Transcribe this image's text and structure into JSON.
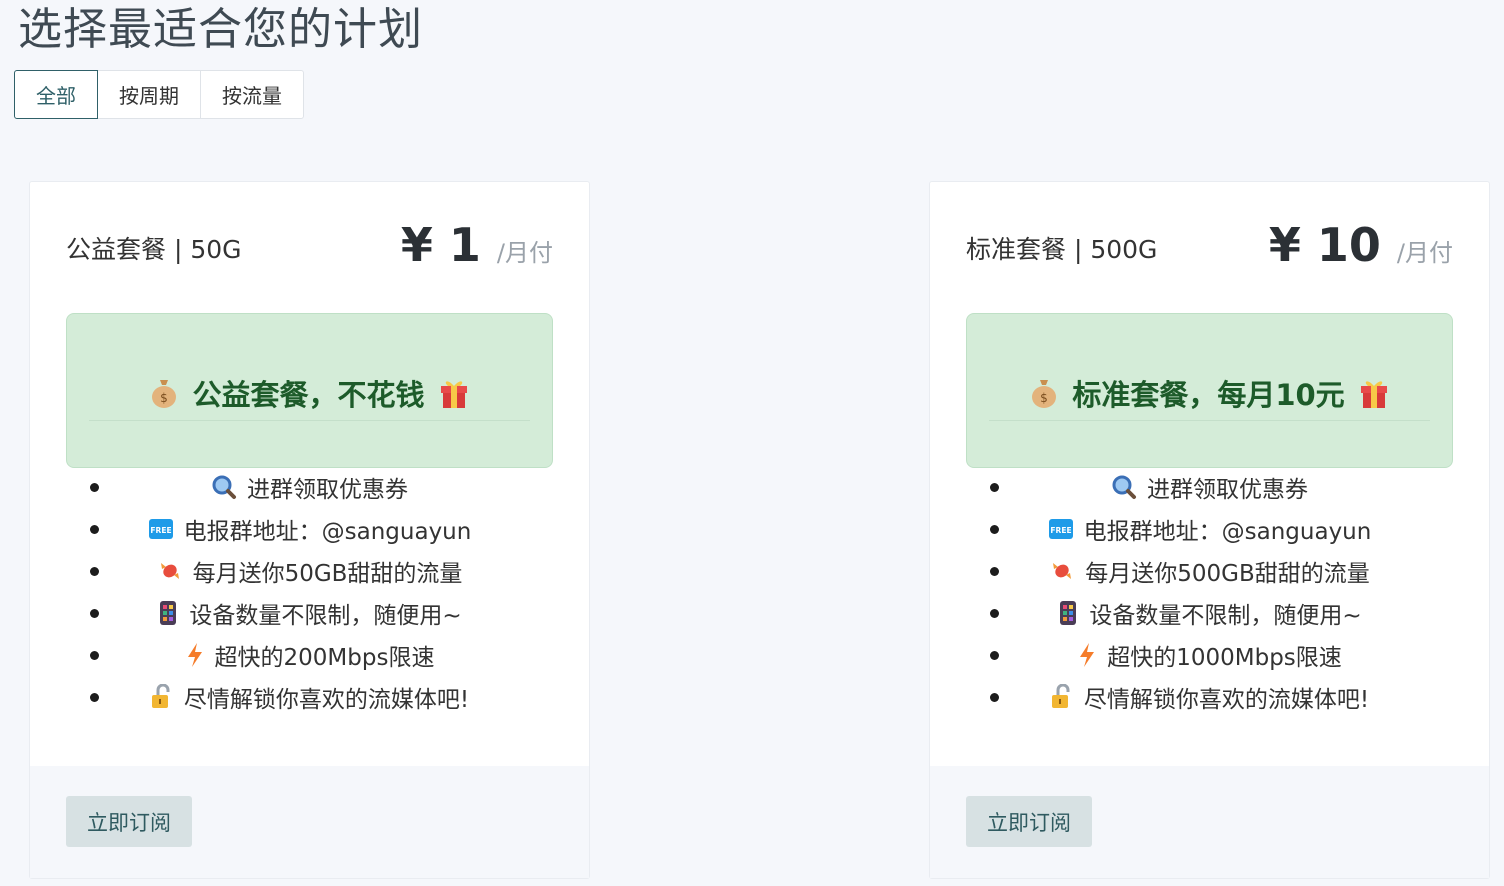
{
  "page_title": "选择最适合您的计划",
  "tabs": [
    {
      "label": "全部",
      "active": true
    },
    {
      "label": "按周期",
      "active": false
    },
    {
      "label": "按流量",
      "active": false
    }
  ],
  "plans": [
    {
      "name": "公益套餐 | 50G",
      "price": "¥ 1",
      "period": "/月付",
      "banner": {
        "left_icon": "money-bag-icon",
        "text": "公益套餐，不花钱",
        "right_icon": "gift-icon"
      },
      "features": [
        {
          "icon": "magnifier-icon",
          "text": "进群领取优惠券"
        },
        {
          "icon": "free-badge-icon",
          "text": "电报群地址：@sanguayun"
        },
        {
          "icon": "candy-icon",
          "text": "每月送你50GB甜甜的流量"
        },
        {
          "icon": "phone-icon",
          "text": "设备数量不限制，随便用~"
        },
        {
          "icon": "lightning-icon",
          "text": "超快的200Mbps限速"
        },
        {
          "icon": "unlock-icon",
          "text": "尽情解锁你喜欢的流媒体吧!"
        }
      ],
      "button_label": "立即订阅"
    },
    {
      "name": "标准套餐 | 500G",
      "price": "¥ 10",
      "period": "/月付",
      "banner": {
        "left_icon": "money-bag-icon",
        "text": "标准套餐，每月10元",
        "right_icon": "gift-icon"
      },
      "features": [
        {
          "icon": "magnifier-icon",
          "text": "进群领取优惠券"
        },
        {
          "icon": "free-badge-icon",
          "text": "电报群地址：@sanguayun"
        },
        {
          "icon": "candy-icon",
          "text": "每月送你500GB甜甜的流量"
        },
        {
          "icon": "phone-icon",
          "text": "设备数量不限制，随便用~"
        },
        {
          "icon": "lightning-icon",
          "text": "超快的1000Mbps限速"
        },
        {
          "icon": "unlock-icon",
          "text": "尽情解锁你喜欢的流媒体吧!"
        }
      ],
      "button_label": "立即订阅"
    }
  ],
  "colors": {
    "background": "#f5f7fb",
    "active_tab": "#2f6068",
    "banner_bg": "#d4ecd8",
    "banner_text": "#1d5b2a",
    "button_bg": "#d7e1e3"
  }
}
